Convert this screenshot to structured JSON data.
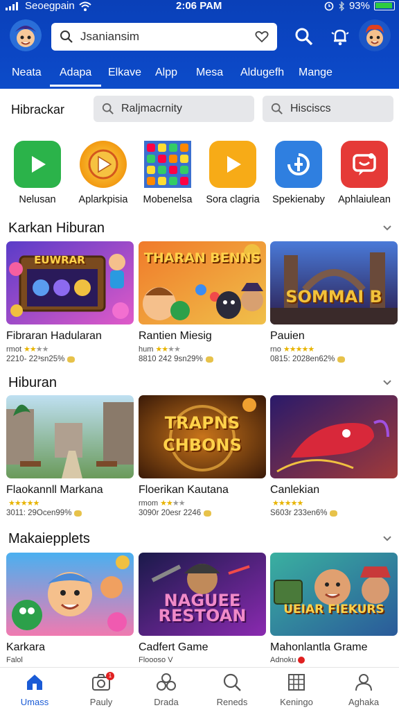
{
  "status_bar": {
    "carrier": "Seoegpain",
    "time": "2:06 PAM",
    "battery": "93%"
  },
  "header": {
    "search_value": "Jsaniansim",
    "categories": [
      "Neata",
      "Adapa",
      "Elkave",
      "Alpp",
      "Mesa",
      "Aldugefh",
      "Mange"
    ],
    "active_category": "Adapa"
  },
  "filter": {
    "title": "Hibrackar",
    "search1": "Raljmacrnity",
    "search2": "Hisciscs"
  },
  "apps": [
    {
      "label": "Nelusan",
      "color": "#2bb34a"
    },
    {
      "label": "Aplarkpisia",
      "color": "#f2a21c"
    },
    {
      "label": "Mobenelsa",
      "color": "#3b7bd8"
    },
    {
      "label": "Sora clagria",
      "color": "#f7ab17"
    },
    {
      "label": "Spekienaby",
      "color": "#2f7fe0"
    },
    {
      "label": "Aphlaiulean",
      "color": "#e53a37"
    }
  ],
  "sections": [
    {
      "title": "Karkan Hiburan",
      "cards": [
        {
          "title": "Fibraran Hadularan",
          "sub": "rmot",
          "rating": 2,
          "meta": "2210- 22³sn25%",
          "art": "EUWRAR"
        },
        {
          "title": "Rantien Miesig",
          "sub": "hum",
          "rating": 2,
          "meta": "8810 242 9sn29%",
          "art": "THARAN BENNS"
        },
        {
          "title": "Pauien",
          "sub": "rno",
          "rating": 5,
          "meta": "0815: 2028en62%",
          "art": "SOMMAI B"
        }
      ]
    },
    {
      "title": "Hiburan",
      "cards": [
        {
          "title": "Flaokannll Markana",
          "sub": "",
          "rating": 5,
          "meta": "3011: 29Ocen99%",
          "art": ""
        },
        {
          "title": "Floerikan Kautana",
          "sub": "rmom",
          "rating": 3,
          "meta": "3090r 20esr 2246",
          "art": "TRAPNS CHBONS"
        },
        {
          "title": "Canlekian",
          "sub": "",
          "rating": 5,
          "meta": "S603r 233en6%",
          "art": ""
        }
      ]
    },
    {
      "title": "Makaiepplets",
      "cards": [
        {
          "title": "Karkara",
          "sub": "Falol",
          "rating": 0,
          "meta": "",
          "art": ""
        },
        {
          "title": "Cadfert Game",
          "sub": "Floooso V",
          "rating": 0,
          "meta": "",
          "art": "NAGUEE RESTOAN"
        },
        {
          "title": "Mahonlantla Grame",
          "sub": "Adnoku",
          "rating": 0,
          "meta": "",
          "art": "UEIAR FIEKURS"
        }
      ]
    }
  ],
  "bottom_nav": [
    {
      "label": "Umass",
      "icon": "home-icon",
      "active": true
    },
    {
      "label": "Pauly",
      "icon": "camera-icon",
      "badge": "1"
    },
    {
      "label": "Drada",
      "icon": "circles-icon"
    },
    {
      "label": "Reneds",
      "icon": "search-icon"
    },
    {
      "label": "Keningo",
      "icon": "grid-icon"
    },
    {
      "label": "Aghaka",
      "icon": "person-icon"
    }
  ],
  "colors": {
    "header_blue": "#0b46c4",
    "accent": "#1a5bd6",
    "star": "#e8b400"
  }
}
